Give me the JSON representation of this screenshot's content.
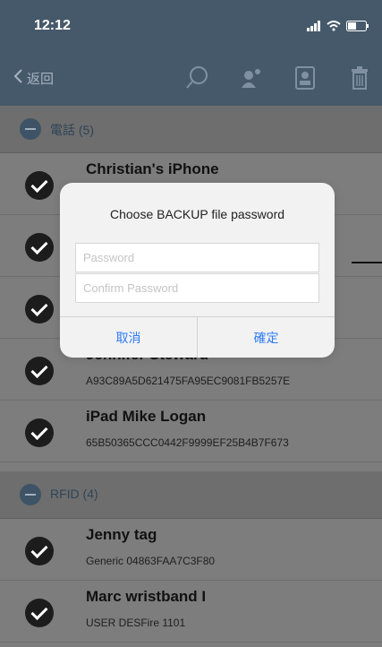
{
  "status": {
    "time": "12:12"
  },
  "nav": {
    "back_label": "返回"
  },
  "sections": [
    {
      "title": "電話 (5)"
    },
    {
      "title": "RFID (4)"
    }
  ],
  "devices": [
    {
      "name": "Christian's iPhone",
      "sub": ""
    },
    {
      "name": "",
      "sub": ""
    },
    {
      "name": "",
      "sub": ""
    },
    {
      "name": "Jennifer Steward",
      "sub": "A93C89A5D621475FA95EC9081FB5257E"
    },
    {
      "name": "iPad Mike Logan",
      "sub": "65B50365CCC0442F9999EF25B4B7F673"
    }
  ],
  "rfid": [
    {
      "name": "Jenny tag",
      "sub": "Generic 04863FAA7C3F80"
    },
    {
      "name": "Marc wristband I",
      "sub": "USER DESFire 1101"
    }
  ],
  "dialog": {
    "title": "Choose BACKUP file password",
    "password_placeholder": "Password",
    "confirm_placeholder": "Confirm Password",
    "cancel_label": "取消",
    "ok_label": "確定"
  }
}
